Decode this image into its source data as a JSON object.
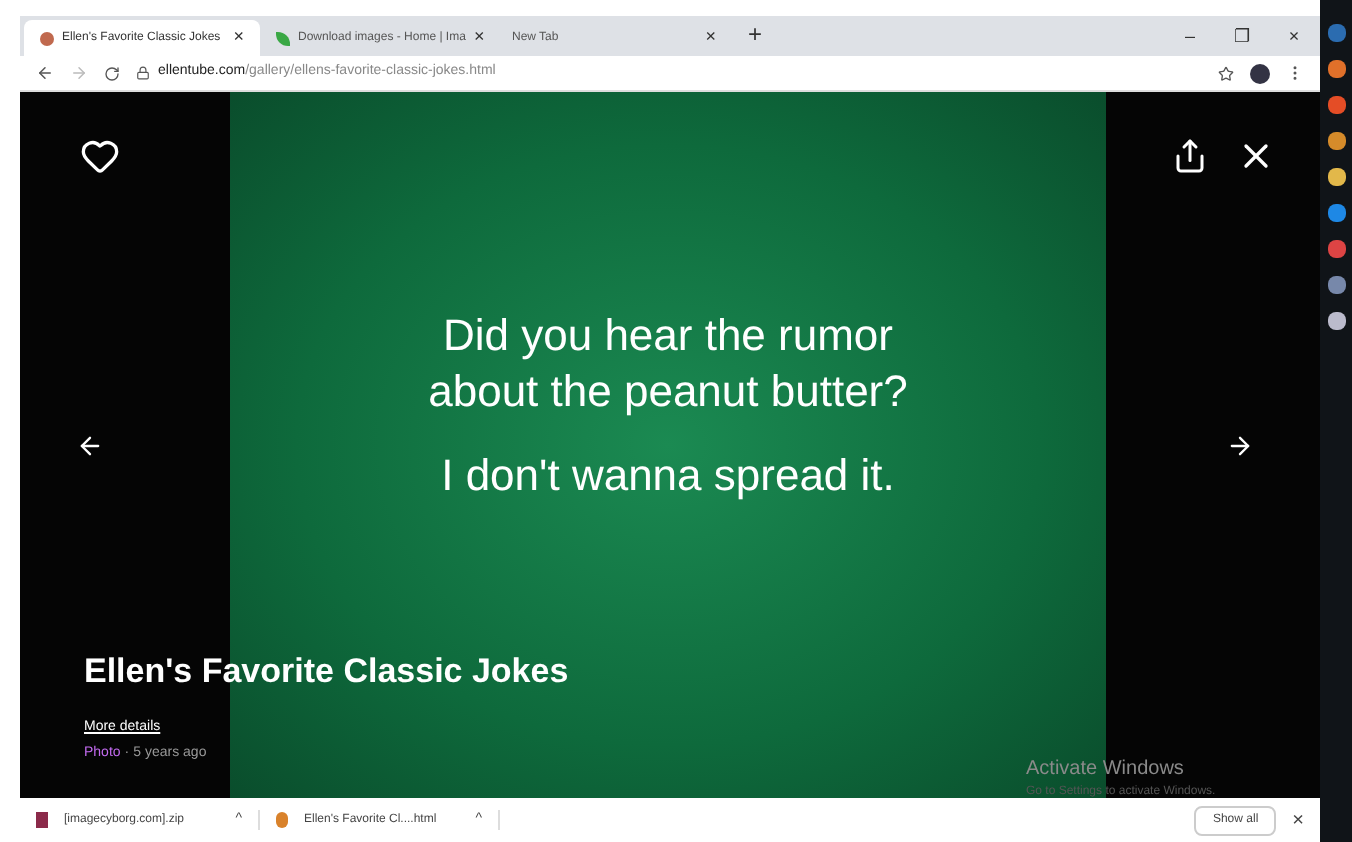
{
  "tabs": [
    {
      "title": "Ellen's Favorite Classic Jokes",
      "selected": true,
      "close": "×",
      "kind": "photo"
    },
    {
      "title": "Download images - Home | Ima",
      "selected": false,
      "close": "×",
      "kind": "leaf"
    },
    {
      "title": "New Tab",
      "selected": false,
      "close": "×",
      "kind": "blank"
    }
  ],
  "new_tab": "+",
  "window_controls": [
    "–",
    "❐",
    "×"
  ],
  "address": {
    "host": "ellentube.com",
    "path": "/gallery/ellens-favorite-classic-jokes.html"
  },
  "slide": {
    "lines": [
      "Did you hear the rumor",
      "about the peanut butter?",
      "I don't wanna spread it."
    ]
  },
  "caption": {
    "title": "Ellen's Favorite Classic Jokes",
    "link": "More details",
    "type": "Photo",
    "separator": "·",
    "age": "5 years ago"
  },
  "activation": {
    "title": "Activate Windows",
    "hint": "Go to Settings to activate Windows."
  },
  "downloads": [
    {
      "name": "[imagecyborg.com].zip",
      "caret": "^"
    },
    {
      "name": "Ellen's Favorite Cl....html",
      "caret": "^"
    }
  ],
  "show_all": "Show all",
  "downloads_close": "×"
}
